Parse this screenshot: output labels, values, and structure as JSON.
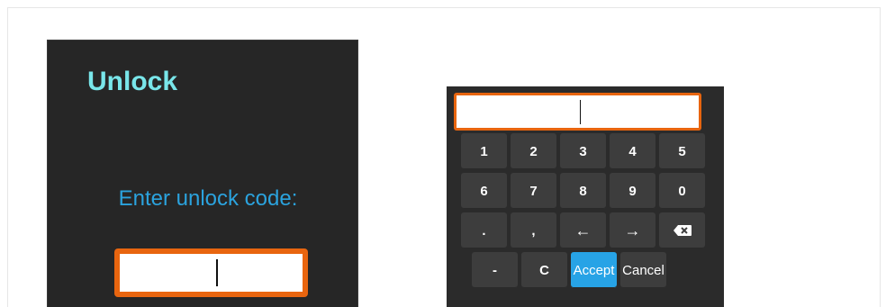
{
  "unlock_dialog": {
    "title": "Unlock",
    "prompt": "Enter unlock code:",
    "input_value": ""
  },
  "keyboard": {
    "input_value": "",
    "rows": [
      [
        "1",
        "2",
        "3",
        "4",
        "5"
      ],
      [
        "6",
        "7",
        "8",
        "9",
        "0"
      ],
      [
        ".",
        ",",
        "←",
        "→",
        "backspace-icon"
      ],
      [
        "-",
        "C",
        "Accept",
        "Cancel"
      ]
    ]
  },
  "colors": {
    "panel_bg": "#262626",
    "title": "#79e6ea",
    "prompt": "#2ba3de",
    "input_border": "#e8650f",
    "accept": "#27a3e6",
    "key_bg": "#3d3d3d"
  }
}
